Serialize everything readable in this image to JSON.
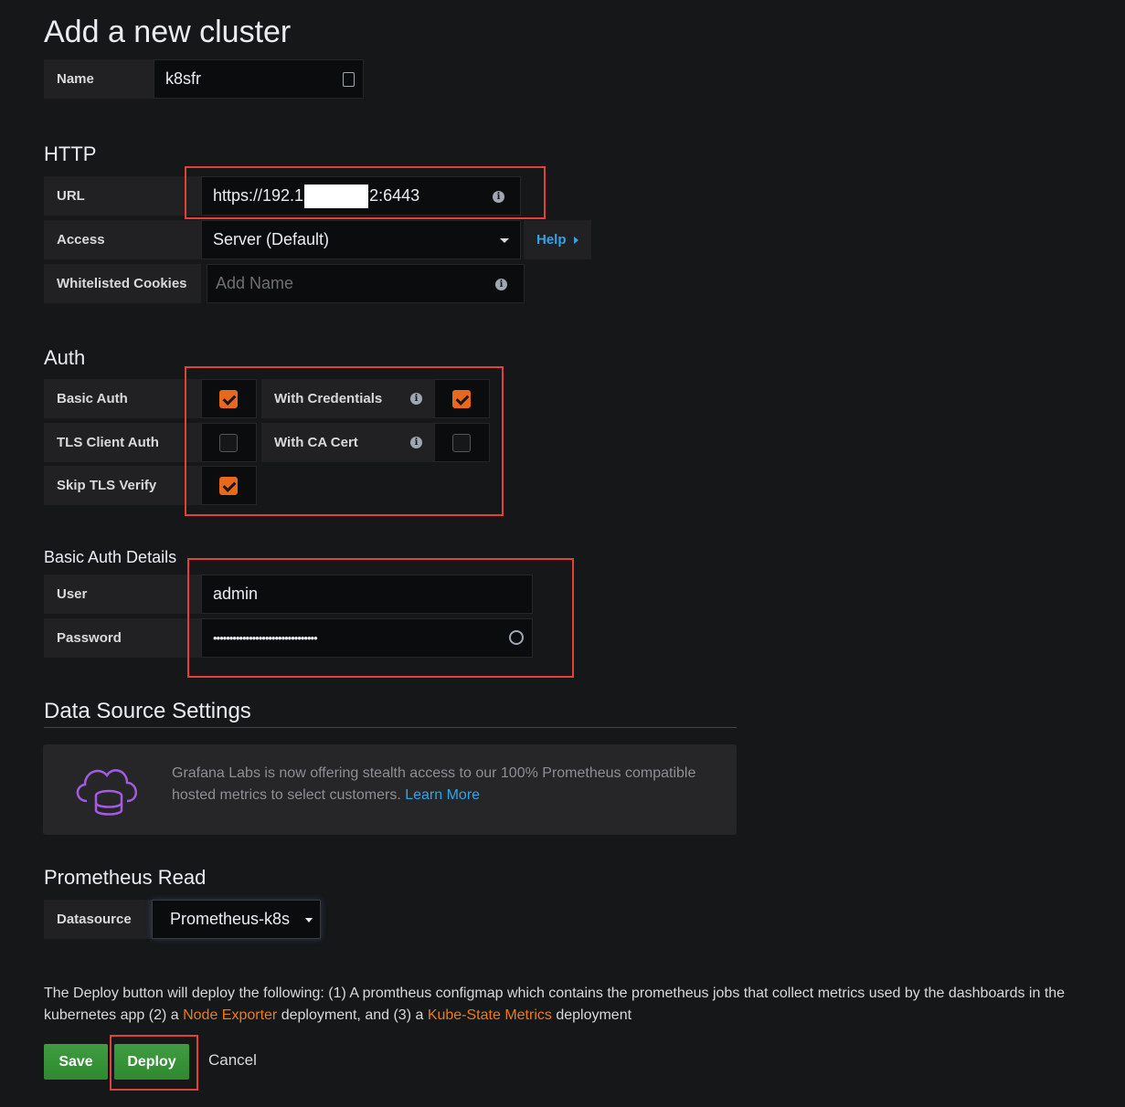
{
  "page": {
    "title": "Add a new cluster"
  },
  "name_field": {
    "label": "Name",
    "value": "k8sfr"
  },
  "http": {
    "heading": "HTTP",
    "url": {
      "label": "URL",
      "value_prefix": "https://192.1",
      "value_suffix": "2:6443"
    },
    "access": {
      "label": "Access",
      "value": "Server (Default)",
      "help": "Help"
    },
    "cookies": {
      "label": "Whitelisted Cookies",
      "placeholder": "Add Name"
    }
  },
  "auth": {
    "heading": "Auth",
    "basic_auth": {
      "label": "Basic Auth",
      "checked": true
    },
    "with_credentials": {
      "label": "With Credentials",
      "checked": true
    },
    "tls_client_auth": {
      "label": "TLS Client Auth",
      "checked": false
    },
    "with_ca_cert": {
      "label": "With CA Cert",
      "checked": false
    },
    "skip_tls_verify": {
      "label": "Skip TLS Verify",
      "checked": true
    }
  },
  "basic_auth_details": {
    "heading": "Basic Auth Details",
    "user": {
      "label": "User",
      "value": "admin"
    },
    "password": {
      "label": "Password",
      "value": "••••••••••••••••••••••••••••••••"
    }
  },
  "datasource_settings": {
    "heading": "Data Source Settings",
    "promo_line1": "Grafana Labs is now offering stealth access to our 100% Prometheus compatible",
    "promo_line2": "hosted metrics to select customers.",
    "learn_more": "Learn More"
  },
  "prometheus_read": {
    "heading": "Prometheus Read",
    "datasource_label": "Datasource",
    "datasource_value": "Prometheus-k8s"
  },
  "deploy_note": {
    "part1": "The Deploy button will deploy the following: (1) A promtheus configmap which contains the prometheus jobs that collect metrics used by the dashboards in the",
    "part2": "kubernetes app (2) a ",
    "node_exporter": "Node Exporter",
    "part3": " deployment, and (3) a ",
    "kube_state": "Kube-State Metrics",
    "part4": " deployment"
  },
  "actions": {
    "save": "Save",
    "deploy": "Deploy",
    "cancel": "Cancel"
  },
  "colors": {
    "accent_orange": "#eb7b18",
    "link_blue": "#33a2e5",
    "button_green": "#3f9c3f",
    "highlight_red": "#e2403a"
  }
}
